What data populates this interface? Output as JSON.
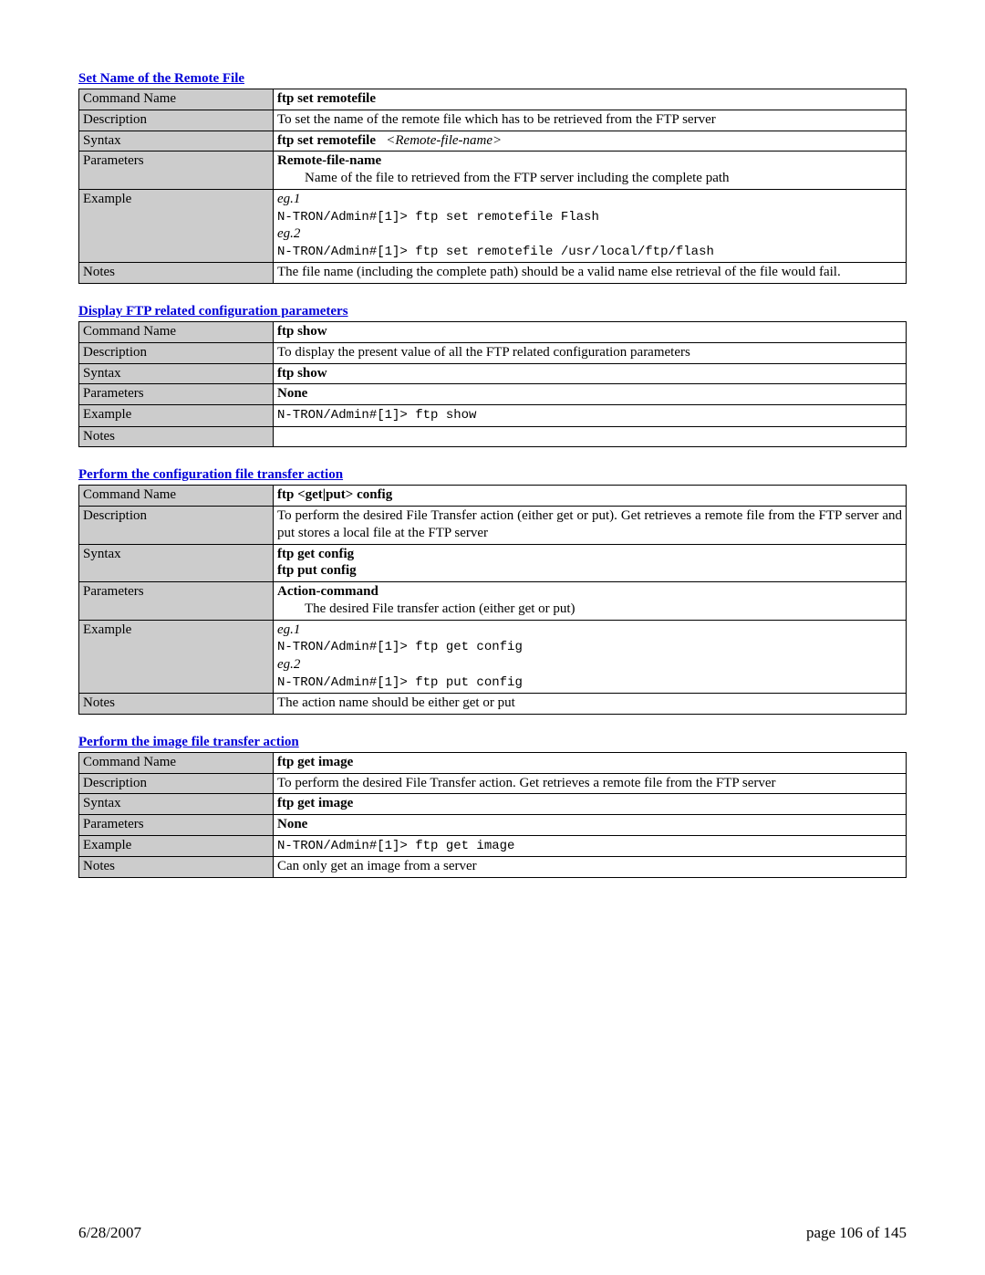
{
  "labels": {
    "command_name": "Command Name",
    "description": "Description",
    "syntax": "Syntax",
    "parameters": "Parameters",
    "example": "Example",
    "notes": "Notes"
  },
  "sections": [
    {
      "title": "Set Name of the Remote File",
      "command_name": "ftp set remotefile",
      "description": "To set the name of the remote file which has to be retrieved from the FTP server",
      "syntax_cmd": "ftp set remotefile",
      "syntax_arg": "<Remote-file-name>",
      "param_name": "Remote-file-name",
      "param_desc": "Name of the file to retrieved from the FTP server including the complete path",
      "eg1_label": "eg.1",
      "eg1_text": "N-TRON/Admin#[1]> ftp set remotefile Flash",
      "eg2_label": "eg.2",
      "eg2_text": "N-TRON/Admin#[1]> ftp set remotefile /usr/local/ftp/flash",
      "notes": "The file name (including the complete path) should be a valid name else retrieval of the file would fail."
    },
    {
      "title": "Display FTP related configuration parameters",
      "command_name": "ftp show",
      "description": "To display the present value of all the FTP related configuration parameters",
      "syntax_cmd": "ftp show",
      "param_name": "None",
      "eg1_text": "N-TRON/Admin#[1]> ftp show",
      "notes": ""
    },
    {
      "title": "Perform the configuration file transfer action",
      "command_name": "ftp <get|put> config",
      "description": "To perform the desired File Transfer action (either get or put). Get retrieves a remote file from the FTP server and put stores a local file at the FTP server",
      "syntax_cmd_l1": "ftp get config",
      "syntax_cmd_l2": "ftp put config",
      "param_name": "Action-command",
      "param_desc": "The desired File transfer action (either get or put)",
      "eg1_label": "eg.1",
      "eg1_text": "N-TRON/Admin#[1]> ftp get config",
      "eg2_label": "eg.2",
      "eg2_text": "N-TRON/Admin#[1]> ftp put config",
      "notes": "The action name should be either get or put"
    },
    {
      "title": "Perform the image file transfer action",
      "command_name": "ftp get image",
      "description": "To perform the desired File Transfer action. Get retrieves a remote file from the FTP server",
      "syntax_cmd": "ftp get image",
      "param_name": "None",
      "eg1_text": "N-TRON/Admin#[1]> ftp get image",
      "notes": "Can only get an image from a server"
    }
  ],
  "footer": {
    "date": "6/28/2007",
    "page": "page 106 of 145"
  }
}
